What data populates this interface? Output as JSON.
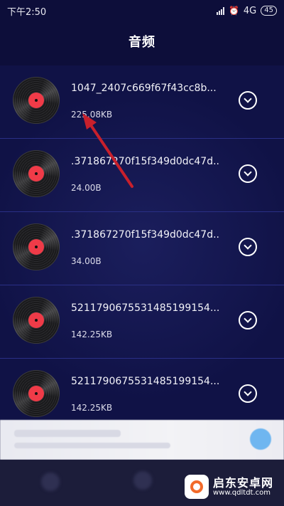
{
  "status_bar": {
    "time": "下午2:50",
    "network": "4G",
    "battery": "45"
  },
  "header": {
    "title": "音频"
  },
  "items": [
    {
      "name": "1047_2407c669f67f43cc8b...",
      "size": "225.08KB"
    },
    {
      "name": ".371867270f15f349d0dc47d...",
      "size": "24.00B"
    },
    {
      "name": ".371867270f15f349d0dc47d...",
      "size": "34.00B"
    },
    {
      "name": "5211790675531485199154...",
      "size": "142.25KB"
    },
    {
      "name": "5211790675531485199154...",
      "size": "142.25KB"
    }
  ],
  "watermark": {
    "title": "启东安卓网",
    "url": "www.qdltdt.com"
  },
  "colors": {
    "accent": "#ef3b48",
    "background": "#0d0e3a",
    "divider": "#2a2f86"
  }
}
